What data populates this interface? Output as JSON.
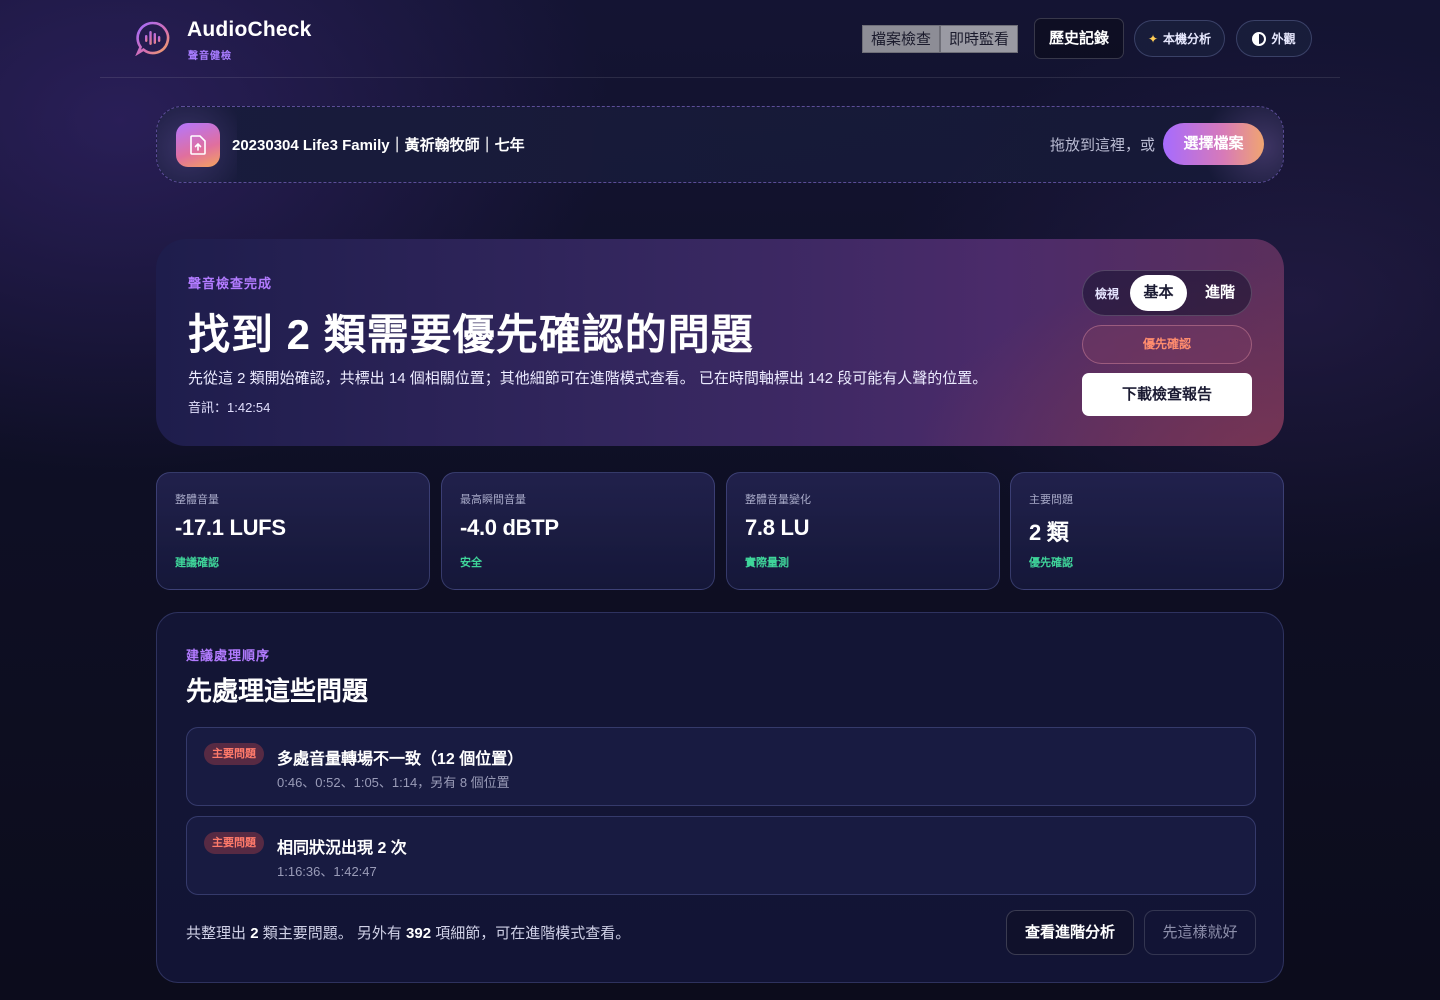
{
  "header": {
    "brand_name": "AudioCheck",
    "brand_sub": "聲音健檢",
    "tabs": [
      {
        "label": "檔案檢查"
      },
      {
        "label": "即時監看"
      }
    ],
    "history_label": "歷史記錄",
    "local_label": "本機分析",
    "local_icon": "sparkle-icon",
    "theme_label": "外觀",
    "theme_icon": "contrast-icon"
  },
  "file": {
    "name": "20230304 Life3 Family｜黃祈翰牧師｜七年",
    "drop_text": "拖放到這裡，或",
    "choose_label": "選擇檔案",
    "icon": "upload-file-icon"
  },
  "hero": {
    "eyebrow": "聲音檢查完成",
    "title": "找到 2 類需要優先確認的問題",
    "description": "先從這 2 類開始確認，共標出 14 個相關位置；其他細節可在進階模式查看。 已在時間軸標出 142 段可能有人聲的位置。",
    "meta": "音訊：1:42:54",
    "view_label": "檢視",
    "view_basic": "基本",
    "view_advanced": "進階",
    "priority_label": "優先確認",
    "download_label": "下載檢查報告"
  },
  "stats": [
    {
      "label": "整體音量",
      "value": "-17.1 LUFS",
      "note": "建議確認"
    },
    {
      "label": "最高瞬間音量",
      "value": "-4.0 dBTP",
      "note": "安全"
    },
    {
      "label": "整體音量變化",
      "value": "7.8 LU",
      "note": "實際量測"
    },
    {
      "label": "主要問題",
      "value": "2 類",
      "note": "優先確認"
    }
  ],
  "issues_panel": {
    "eyebrow": "建議處理順序",
    "title": "先處理這些問題",
    "issues": [
      {
        "badge": "主要問題",
        "title": "多處音量轉場不一致（12 個位置）",
        "detail": "0:46、0:52、1:05、1:14，另有 8 個位置"
      },
      {
        "badge": "主要問題",
        "title": "相同狀況出現 2 次",
        "detail": "1:16:36、1:42:47"
      }
    ],
    "summary": {
      "prefix": "共整理出",
      "main_count": "2",
      "middle": "類主要問題。 另外有",
      "detail_count": "392",
      "suffix": "項細節，可在進階模式查看。"
    },
    "advanced_button": "查看進階分析",
    "ok_button": "先這樣就好"
  },
  "colors": {
    "accent": "#b27bff",
    "success": "#3fd59a",
    "warning": "#ff7a6a"
  }
}
